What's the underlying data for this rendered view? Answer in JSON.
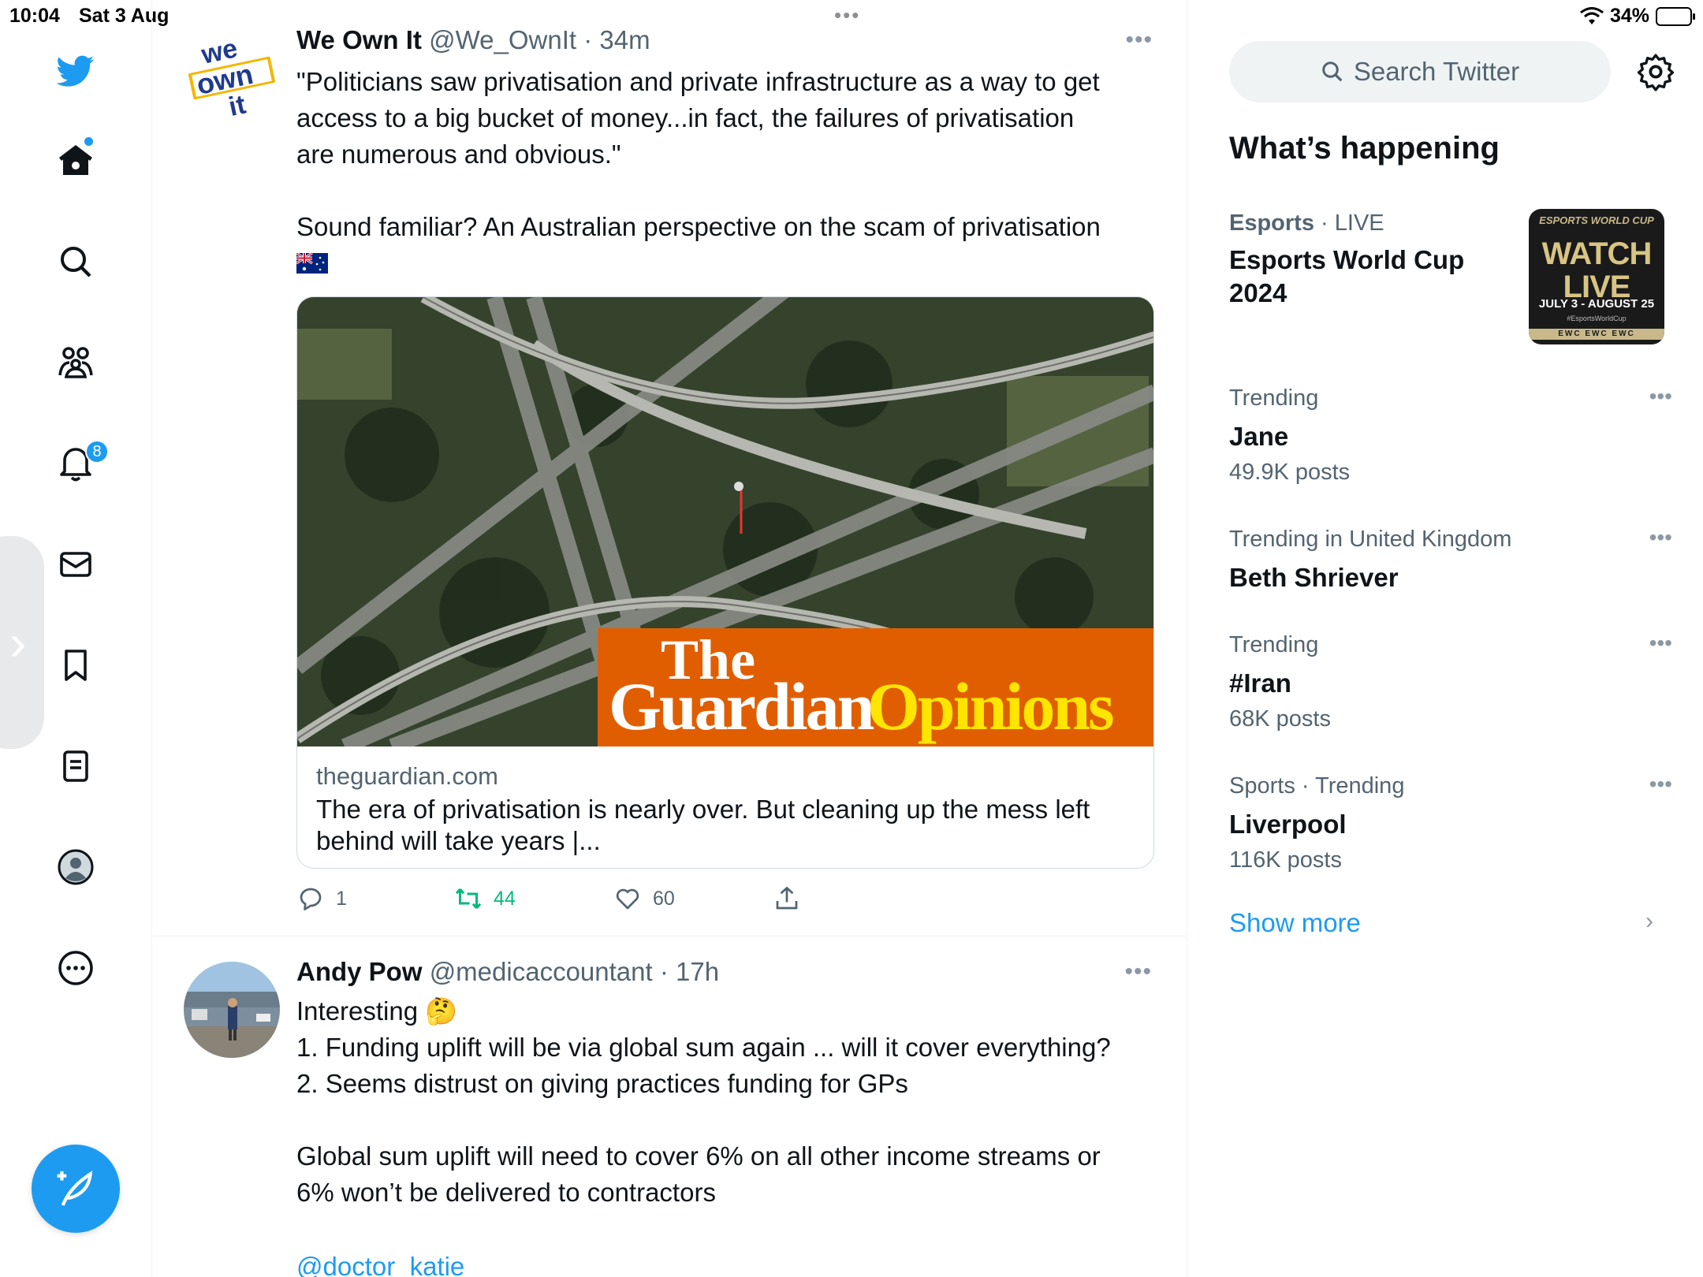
{
  "status_bar": {
    "time": "10:04",
    "date": "Sat 3 Aug",
    "battery": "34%",
    "battery_level": 0.34
  },
  "nav": {
    "items": [
      "twitter-logo",
      "home",
      "explore",
      "communities",
      "notifications",
      "messages",
      "bookmarks",
      "lists",
      "profile",
      "more"
    ],
    "notification_count": "8"
  },
  "tweets": [
    {
      "name": "We Own It",
      "handle": "@We_OwnIt",
      "time": "34m",
      "avatar_text": [
        "we",
        "own",
        "it"
      ],
      "body": [
        "\"Politicians saw privatisation and private infrastructure as a way to get",
        "access to a big bucket of money...in fact, the failures of privatisation",
        "are numerous and obvious.\"",
        "",
        "Sound familiar? An Australian perspective on the scam of privatisation"
      ],
      "card": {
        "image_text": {
          "the": "The",
          "guardian": "Guardian",
          "opinions": "Opinions"
        },
        "domain": "theguardian.com",
        "title": "The era of privatisation is nearly over. But cleaning up the mess left behind will take years |..."
      },
      "actions": {
        "replies": "1",
        "retweets": "44",
        "likes": "60"
      }
    },
    {
      "name": "Andy Pow",
      "handle": "@medicaccountant",
      "time": "17h",
      "body": [
        "Interesting 🤔",
        "1. Funding uplift will be via global sum again ... will it cover everything?",
        "2. Seems distrust on giving practices funding for GPs",
        "",
        "Global sum uplift will need to cover 6% on all other income streams or",
        "6% won’t be delivered to contractors"
      ],
      "mention": "@doctor_katie"
    }
  ],
  "sidebar": {
    "search_placeholder": "Search Twitter",
    "section_title": "What’s happening",
    "trends": [
      {
        "category": "Esports",
        "context": "LIVE",
        "name": "Esports World Cup 2024",
        "count": "",
        "thumb": {
          "small": "ESPORTS WORLD CUP",
          "big1": "WATCH",
          "big2": "LIVE",
          "dates": "JULY 3 - AUGUST 25",
          "tag": "#EsportsWorldCup",
          "strip": "EWC EWC EWC"
        }
      },
      {
        "category": "Trending",
        "context": "",
        "name": "Jane",
        "count": "49.9K posts"
      },
      {
        "category": "Trending in United Kingdom",
        "context": "",
        "name": "Beth Shriever",
        "count": ""
      },
      {
        "category": "Trending",
        "context": "",
        "name": "#Iran",
        "count": "68K posts"
      },
      {
        "category": "Sports · Trending",
        "context": "",
        "name": "Liverpool",
        "count": "116K posts"
      }
    ],
    "show_more": "Show more"
  },
  "colors": {
    "accent": "#1d9bf0",
    "retweet": "#00ba7c",
    "guardian_orange": "#e05e00",
    "guardian_yellow": "#ffe500"
  }
}
